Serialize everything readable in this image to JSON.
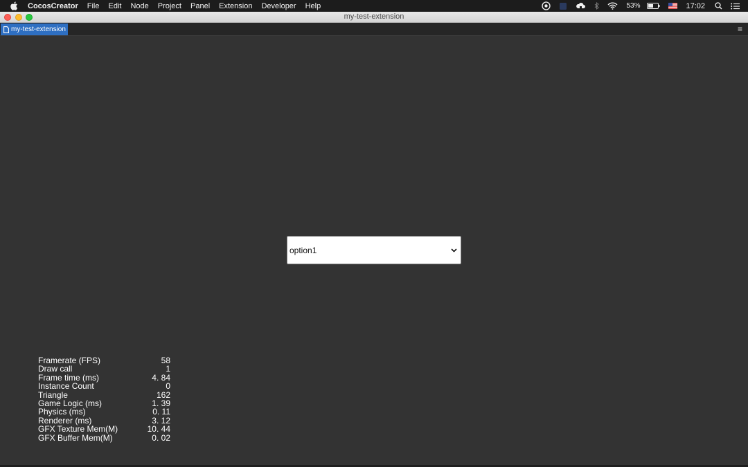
{
  "menubar": {
    "app_name": "CocosCreator",
    "items": [
      "File",
      "Edit",
      "Node",
      "Project",
      "Panel",
      "Extension",
      "Developer",
      "Help"
    ],
    "battery": "53%",
    "clock": "17:02"
  },
  "window": {
    "title": "my-test-extension"
  },
  "tabs": {
    "active_label": "my-test-extension",
    "accent": "#2e6fc2"
  },
  "panel": {
    "dropdown": {
      "selected": "option1"
    },
    "stats": [
      {
        "label": "Framerate (FPS)",
        "value": "58"
      },
      {
        "label": "Draw call",
        "value": "1"
      },
      {
        "label": "Frame time (ms)",
        "value": "4. 84"
      },
      {
        "label": "Instance Count",
        "value": "0"
      },
      {
        "label": "Triangle",
        "value": "162"
      },
      {
        "label": "Game Logic (ms)",
        "value": "1. 39"
      },
      {
        "label": "Physics (ms)",
        "value": "0. 11"
      },
      {
        "label": "Renderer (ms)",
        "value": "3. 12"
      },
      {
        "label": "GFX Texture Mem(M)",
        "value": "10. 44"
      },
      {
        "label": "GFX Buffer Mem(M)",
        "value": "0. 02"
      }
    ]
  }
}
